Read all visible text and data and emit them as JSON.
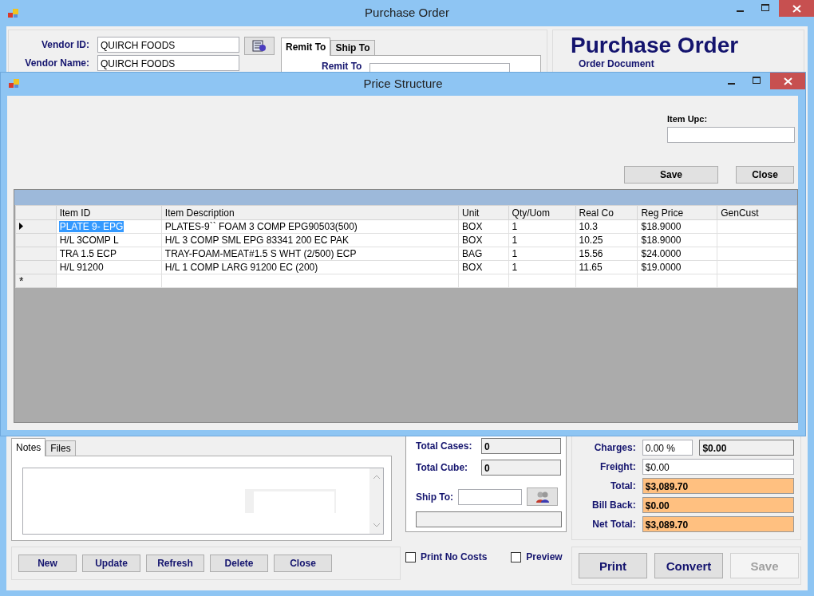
{
  "main_window": {
    "title": "Purchase Order",
    "vendor_fields": [
      {
        "label": "Vendor ID:",
        "value": "QUIRCH FOODS"
      },
      {
        "label": "Vendor Name:",
        "value": "QUIRCH FOODS"
      }
    ],
    "address_tabs": [
      {
        "label": "Remit To",
        "selected": true
      },
      {
        "label": "Ship To",
        "selected": false
      }
    ],
    "remit_label": "Remit To",
    "header": {
      "title": "Purchase Order",
      "subtitle": "Order Document"
    },
    "notes_tabs": [
      {
        "label": "Notes",
        "selected": true
      },
      {
        "label": "Files",
        "selected": false
      }
    ],
    "action_buttons": [
      "New",
      "Update",
      "Refresh",
      "Delete",
      "Close"
    ],
    "totals": [
      {
        "label": "Total Cases:",
        "value": "0"
      },
      {
        "label": "Total Cube:",
        "value": "0"
      }
    ],
    "ship_to": {
      "label": "Ship To:"
    },
    "options": [
      {
        "label": "Print No Costs",
        "checked": false
      },
      {
        "label": "Preview",
        "checked": false
      }
    ],
    "charges": [
      {
        "kind": "split",
        "label": "Charges:",
        "rate": "0.00 %",
        "value": "$0.00"
      },
      {
        "kind": "input",
        "label": "Freight:",
        "value": "$0.00"
      },
      {
        "kind": "highlight",
        "label": "Total:",
        "value": "$3,089.70"
      },
      {
        "kind": "highlight",
        "label": "Bill Back:",
        "value": "$0.00"
      },
      {
        "kind": "highlight",
        "label": "Net Total:",
        "value": "$3,089.70"
      }
    ],
    "print_buttons": [
      {
        "label": "Print",
        "disabled": false
      },
      {
        "label": "Convert",
        "disabled": false
      },
      {
        "label": "Save",
        "disabled": true
      }
    ]
  },
  "dialog": {
    "title": "Price Structure",
    "upc_label": "Item Upc:",
    "buttons": [
      "Save",
      "Close"
    ],
    "grid": {
      "columns": [
        "Item ID",
        "Item Description",
        "Unit",
        "Qty/Uom",
        "Real Co",
        "Reg Price",
        "GenCust"
      ],
      "rows": [
        {
          "selected": true,
          "cells": [
            "PLATE 9- EPG",
            "PLATES-9`` FOAM 3 COMP EPG90503(500)",
            "BOX",
            "1",
            "10.3",
            "$18.9000",
            ""
          ]
        },
        {
          "selected": false,
          "cells": [
            "H/L 3COMP L",
            "H/L 3 COMP SML EPG 83341 200 EC PAK",
            "BOX",
            "1",
            "10.25",
            "$18.9000",
            ""
          ]
        },
        {
          "selected": false,
          "cells": [
            "TRA 1.5 ECP",
            "TRAY-FOAM-MEAT#1.5 S WHT (2/500) ECP",
            "BAG",
            "1",
            "15.56",
            "$24.0000",
            ""
          ]
        },
        {
          "selected": false,
          "cells": [
            "H/L 91200",
            "H/L 1 COMP LARG 91200 EC (200)",
            "BOX",
            "1",
            "11.65",
            "$19.0000",
            ""
          ]
        }
      ],
      "new_row_marker": "*"
    }
  }
}
